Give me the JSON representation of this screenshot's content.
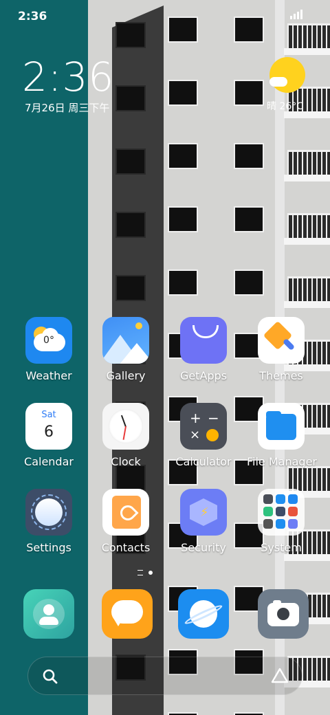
{
  "status_bar": {
    "time": "2:36"
  },
  "lockclock": {
    "time": "2:36",
    "date": "7月26日 周三下午"
  },
  "weather_widget": {
    "text": "晴 26°C",
    "icon": "sun-cloud-icon"
  },
  "apps": [
    {
      "name": "weather",
      "label": "Weather",
      "icon": "weather-icon",
      "badge": "0°"
    },
    {
      "name": "gallery",
      "label": "Gallery",
      "icon": "gallery-icon"
    },
    {
      "name": "getapps",
      "label": "GetApps",
      "icon": "shopping-bag-icon"
    },
    {
      "name": "themes",
      "label": "Themes",
      "icon": "paint-brush-icon"
    },
    {
      "name": "calendar",
      "label": "Calendar",
      "icon": "calendar-icon",
      "day": "Sat",
      "date_num": "6"
    },
    {
      "name": "clock",
      "label": "Clock",
      "icon": "clock-icon"
    },
    {
      "name": "calculator",
      "label": "Calculator",
      "icon": "calculator-icon"
    },
    {
      "name": "file-manager",
      "label": "File Manager",
      "icon": "folder-icon"
    },
    {
      "name": "settings",
      "label": "Settings",
      "icon": "settings-dial-icon"
    },
    {
      "name": "contacts",
      "label": "Contacts",
      "icon": "contacts-book-icon"
    },
    {
      "name": "security",
      "label": "Security",
      "icon": "security-shield-icon"
    },
    {
      "name": "system",
      "label": "System",
      "icon": "folder-grid-icon"
    }
  ],
  "dock": [
    {
      "name": "contacts",
      "icon": "person-icon"
    },
    {
      "name": "messaging",
      "icon": "chat-bubble-icon"
    },
    {
      "name": "browser",
      "icon": "planet-icon"
    },
    {
      "name": "camera",
      "icon": "camera-icon"
    }
  ],
  "search": {
    "icon": "search-icon",
    "assistant_icon": "assistant-triangle-icon"
  },
  "colors": {
    "left_wall": "#0e6468",
    "building": "#d4d4d2",
    "sun": "#ffd21e"
  }
}
